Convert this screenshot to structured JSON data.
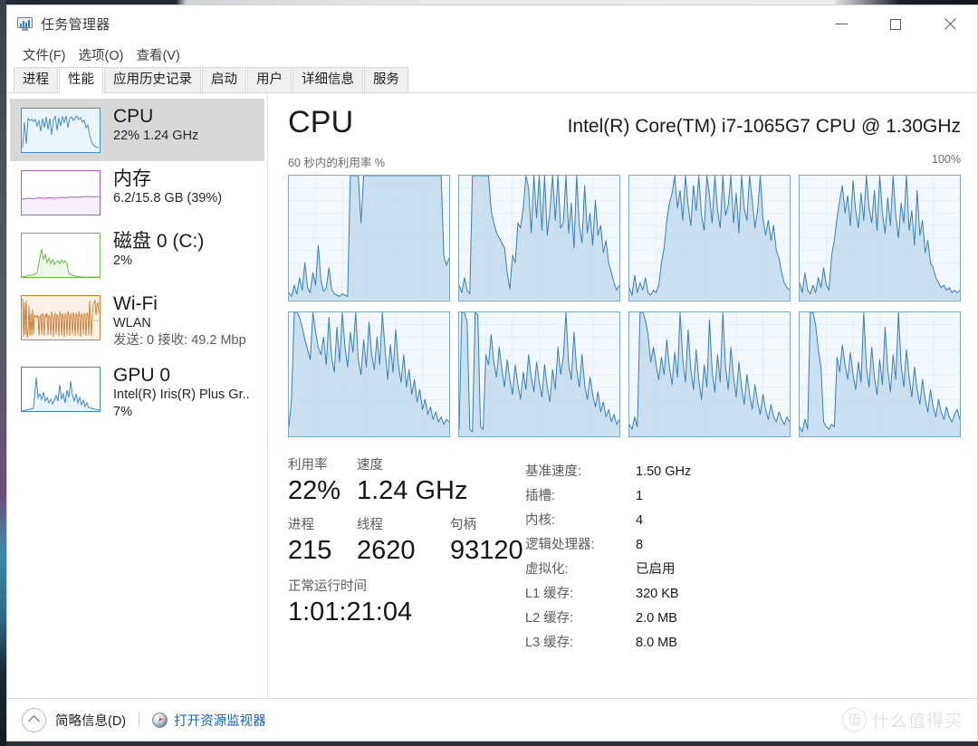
{
  "window": {
    "title": "任务管理器",
    "icon": "task-manager-icon",
    "minimize_label": "–",
    "maximize_label": "□",
    "close_label": "✕"
  },
  "menubar": {
    "items": [
      {
        "label": "文件(F)"
      },
      {
        "label": "选项(O)"
      },
      {
        "label": "查看(V)"
      }
    ]
  },
  "tabs": {
    "items": [
      {
        "label": "进程",
        "active": false
      },
      {
        "label": "性能",
        "active": true
      },
      {
        "label": "应用历史记录",
        "active": false
      },
      {
        "label": "启动",
        "active": false
      },
      {
        "label": "用户",
        "active": false
      },
      {
        "label": "详细信息",
        "active": false
      },
      {
        "label": "服务",
        "active": false
      }
    ]
  },
  "sidebar": {
    "items": [
      {
        "name": "cpu",
        "title": "CPU",
        "sub1": "22% 1.24 GHz",
        "sub2": "",
        "sub3": "",
        "selected": true,
        "line_color": "#4a90b8",
        "fill_color": "#e9f3fa"
      },
      {
        "name": "memory",
        "title": "内存",
        "sub1": "6.2/15.8 GB (39%)",
        "sub2": "",
        "sub3": "",
        "selected": false,
        "line_color": "#b05fc0",
        "fill_color": "#f6eef8"
      },
      {
        "name": "disk-0",
        "title": "磁盘 0 (C:)",
        "sub1": "2%",
        "sub2": "",
        "sub3": "",
        "selected": false,
        "line_color": "#6fb84a",
        "fill_color": "#eef8e8"
      },
      {
        "name": "wifi",
        "title": "Wi-Fi",
        "sub1": "WLAN",
        "sub2": "发送: 0 接收: 49.2 Mbp",
        "sub3": "",
        "selected": false,
        "line_color": "#c97c34",
        "fill_color": "#fbf1e6"
      },
      {
        "name": "gpu-0",
        "title": "GPU 0",
        "sub1": "Intel(R) Iris(R) Plus Gr..",
        "sub2": "7%",
        "sub3": "",
        "selected": false,
        "line_color": "#3f88c5",
        "fill_color": "#e9f3fa"
      }
    ]
  },
  "main": {
    "title": "CPU",
    "cpu_name": "Intel(R) Core(TM) i7-1065G7 CPU @ 1.30GHz",
    "axis_left": "60 秒内的利用率 %",
    "axis_right": "100%",
    "graph_style": {
      "line_color": "#3b7fae",
      "fill_color": "#c3dced",
      "bg_color": "#f2f8fc",
      "grid_color": "#d4e7f3",
      "border_color": "#7fa8c4"
    },
    "stats": {
      "utilization_label": "利用率",
      "utilization_value": "22%",
      "speed_label": "速度",
      "speed_value": "1.24 GHz",
      "processes_label": "进程",
      "processes_value": "215",
      "threads_label": "线程",
      "threads_value": "2620",
      "handles_label": "句柄",
      "handles_value": "93120",
      "uptime_label": "正常运行时间",
      "uptime_value": "1:01:21:04"
    },
    "specs": [
      {
        "key": "基准速度:",
        "value": "1.50 GHz"
      },
      {
        "key": "插槽:",
        "value": "1"
      },
      {
        "key": "内核:",
        "value": "4"
      },
      {
        "key": "逻辑处理器:",
        "value": "8"
      },
      {
        "key": "虚拟化:",
        "value": "已启用"
      },
      {
        "key": "L1 缓存:",
        "value": "320 KB"
      },
      {
        "key": "L2 缓存:",
        "value": "2.0 MB"
      },
      {
        "key": "L3 缓存:",
        "value": "8.0 MB"
      }
    ]
  },
  "statusbar": {
    "summary_label": "简略信息(D)",
    "resmon_label": "打开资源监视器",
    "watermark_badge": "值",
    "watermark_text": "什么值得买"
  },
  "chart_data": {
    "type": "area",
    "title": "60 秒内的利用率 %",
    "ylabel": "%",
    "ylim": [
      0,
      100
    ],
    "xlim": [
      0,
      60
    ],
    "grid": true,
    "legend": "none",
    "note": "8 logical-processor utilization graphs, 4 columns x 2 rows",
    "series": [
      {
        "name": "CPU 0",
        "values": [
          6,
          3,
          12,
          5,
          18,
          8,
          30,
          10,
          6,
          22,
          12,
          44,
          16,
          7,
          10,
          26,
          9,
          5,
          4,
          3,
          5,
          4,
          3,
          100,
          100,
          100,
          100,
          62,
          100,
          100,
          100,
          100,
          100,
          100,
          100,
          100,
          100,
          100,
          100,
          100,
          100,
          100,
          100,
          100,
          100,
          100,
          100,
          100,
          100,
          100,
          100,
          100,
          100,
          100,
          100,
          100,
          100,
          100,
          36,
          28,
          34
        ]
      },
      {
        "name": "CPU 1",
        "values": [
          12,
          6,
          18,
          8,
          5,
          100,
          100,
          100,
          100,
          100,
          100,
          100,
          72,
          62,
          54,
          50,
          46,
          42,
          22,
          9,
          36,
          30,
          62,
          58,
          74,
          100,
          90,
          54,
          100,
          66,
          100,
          56,
          100,
          52,
          72,
          100,
          64,
          100,
          58,
          62,
          100,
          54,
          78,
          42,
          100,
          60,
          46,
          92,
          54,
          70,
          44,
          80,
          52,
          60,
          38,
          48,
          30,
          22,
          14,
          8,
          12
        ]
      },
      {
        "name": "CPU 2",
        "values": [
          10,
          4,
          20,
          6,
          14,
          8,
          18,
          6,
          4,
          8,
          6,
          12,
          30,
          42,
          64,
          78,
          86,
          100,
          74,
          88,
          64,
          100,
          76,
          60,
          92,
          72,
          100,
          68,
          56,
          100,
          84,
          62,
          100,
          72,
          58,
          100,
          68,
          76,
          100,
          62,
          86,
          54,
          100,
          74,
          64,
          100,
          80,
          58,
          72,
          100,
          66,
          52,
          64,
          48,
          60,
          40,
          34,
          22,
          14,
          10,
          8
        ]
      },
      {
        "name": "CPU 3",
        "values": [
          14,
          6,
          22,
          8,
          5,
          12,
          6,
          18,
          10,
          26,
          12,
          8,
          36,
          48,
          66,
          80,
          92,
          70,
          84,
          60,
          96,
          72,
          58,
          86,
          64,
          100,
          74,
          62,
          88,
          56,
          100,
          70,
          54,
          82,
          60,
          100,
          68,
          50,
          78,
          62,
          100,
          56,
          72,
          44,
          88,
          52,
          64,
          38,
          48,
          30,
          26,
          18,
          14,
          10,
          12,
          8,
          10,
          6,
          8,
          6,
          8
        ]
      },
      {
        "name": "CPU 4",
        "values": [
          8,
          30,
          100,
          100,
          96,
          88,
          78,
          70,
          62,
          100,
          84,
          72,
          66,
          80,
          58,
          96,
          64,
          52,
          88,
          60,
          100,
          72,
          56,
          84,
          68,
          100,
          62,
          50,
          78,
          56,
          92,
          66,
          54,
          80,
          58,
          100,
          70,
          46,
          74,
          52,
          86,
          58,
          44,
          66,
          40,
          54,
          34,
          46,
          28,
          38,
          22,
          30,
          18,
          24,
          14,
          20,
          12,
          16,
          10,
          14,
          12
        ]
      },
      {
        "name": "CPU 5",
        "values": [
          6,
          100,
          100,
          92,
          6,
          4,
          100,
          98,
          8,
          6,
          66,
          58,
          82,
          60,
          48,
          72,
          54,
          40,
          62,
          46,
          34,
          58,
          42,
          30,
          52,
          38,
          66,
          48,
          36,
          60,
          44,
          32,
          58,
          40,
          28,
          54,
          38,
          72,
          50,
          64,
          100,
          58,
          46,
          84,
          54,
          40,
          66,
          42,
          30,
          48,
          34,
          24,
          36,
          20,
          28,
          16,
          22,
          12,
          18,
          10,
          14
        ]
      },
      {
        "name": "CPU 6",
        "values": [
          10,
          6,
          16,
          8,
          100,
          100,
          94,
          82,
          60,
          72,
          58,
          46,
          64,
          50,
          78,
          56,
          42,
          68,
          48,
          100,
          62,
          44,
          86,
          54,
          38,
          70,
          46,
          30,
          58,
          40,
          94,
          52,
          36,
          66,
          44,
          100,
          56,
          38,
          72,
          48,
          32,
          60,
          40,
          26,
          50,
          34,
          22,
          42,
          28,
          18,
          34,
          22,
          14,
          26,
          16,
          12,
          20,
          14,
          10,
          16,
          12
        ]
      },
      {
        "name": "CPU 7",
        "values": [
          8,
          4,
          14,
          6,
          100,
          100,
          90,
          70,
          56,
          12,
          8,
          6,
          10,
          8,
          64,
          52,
          74,
          58,
          46,
          68,
          50,
          38,
          60,
          44,
          100,
          56,
          40,
          72,
          48,
          34,
          62,
          42,
          88,
          54,
          36,
          66,
          46,
          100,
          58,
          40,
          70,
          48,
          32,
          56,
          38,
          26,
          46,
          30,
          20,
          38,
          24,
          16,
          30,
          20,
          14,
          24,
          16,
          12,
          18,
          22,
          14
        ]
      }
    ]
  }
}
